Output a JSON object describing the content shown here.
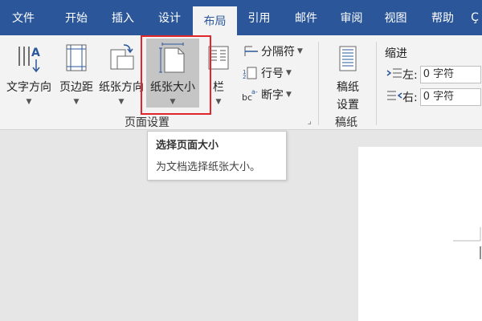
{
  "tabs": [
    {
      "label": "文件",
      "active": false
    },
    {
      "label": "开始",
      "active": false
    },
    {
      "label": "插入",
      "active": false
    },
    {
      "label": "设计",
      "active": false
    },
    {
      "label": "布局",
      "active": true
    },
    {
      "label": "引用",
      "active": false
    },
    {
      "label": "邮件",
      "active": false
    },
    {
      "label": "审阅",
      "active": false
    },
    {
      "label": "视图",
      "active": false
    },
    {
      "label": "帮助",
      "active": false
    },
    {
      "label": "Ç",
      "active": false
    }
  ],
  "page_setup": {
    "text_direction": "文字方向",
    "margins": "页边距",
    "orientation": "纸张方向",
    "size": "纸张大小",
    "columns": "栏",
    "breaks": "分隔符",
    "line_numbers": "行号",
    "hyphenation": "断字",
    "group_label": "页面设置"
  },
  "manuscript": {
    "button_line1": "稿纸",
    "button_line2": "设置",
    "group_label": "稿纸"
  },
  "indent": {
    "title": "缩进",
    "left_label": "左:",
    "left_value": "0 字符",
    "right_label": "右:",
    "right_value": "0 字符"
  },
  "tooltip": {
    "title": "选择页面大小",
    "description": "为文档选择纸张大小。"
  },
  "colors": {
    "tab_bar": "#2b579a",
    "ribbon": "#f3f3f3",
    "highlight": "#e0262a",
    "workspace": "#e6e6e6"
  }
}
